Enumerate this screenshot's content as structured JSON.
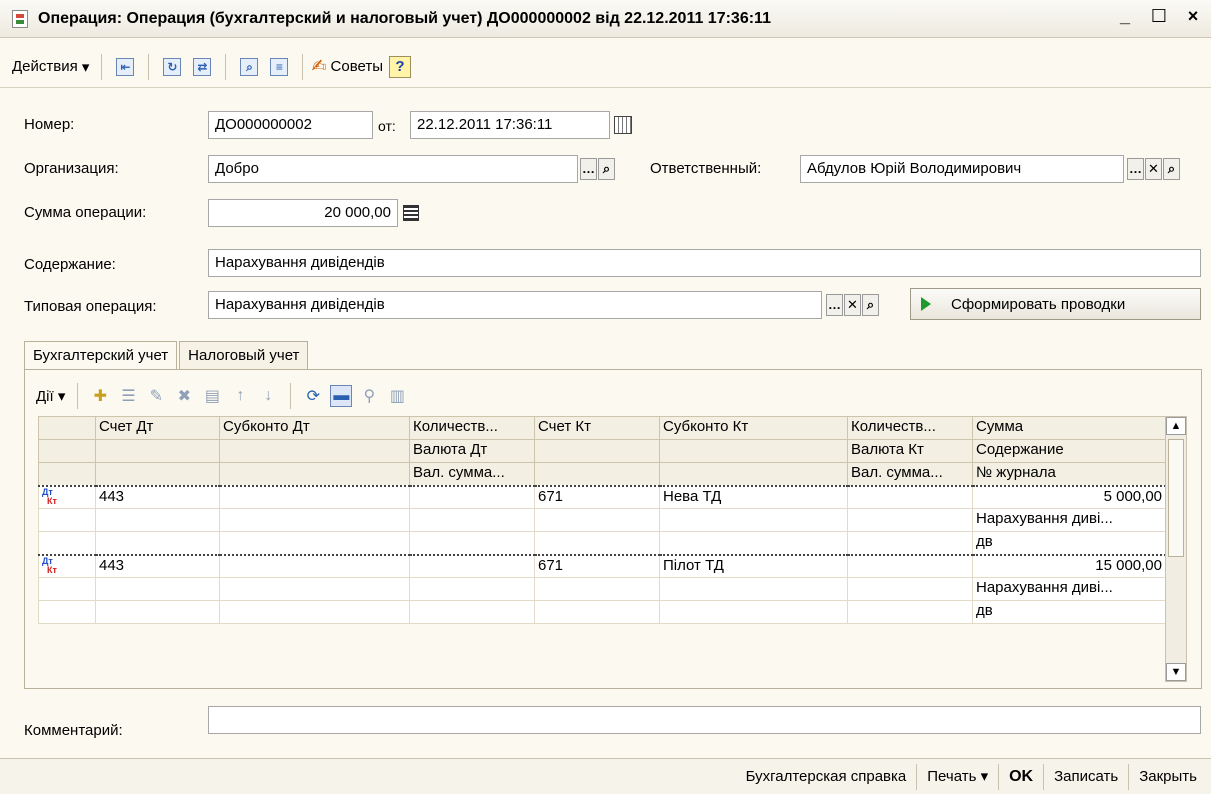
{
  "window": {
    "title": "Операция: Операция (бухгалтерский и налоговый учет) ДО000000002 від 22.12.2011 17:36:11",
    "minimize": "_",
    "maximize": "☐",
    "close": "×"
  },
  "toolbar": {
    "actions_label": "Действия",
    "advice_label": "Советы",
    "help_label": "?"
  },
  "form": {
    "number_label": "Номер:",
    "number_value": "ДО000000002",
    "from_label": "от:",
    "date_value": "22.12.2011 17:36:11",
    "org_label": "Организация:",
    "org_value": "Добро",
    "responsible_label": "Ответственный:",
    "responsible_value": "Абдулов Юрій Володимирович",
    "amount_label": "Сумма операции:",
    "amount_value": "20 000,00",
    "content_label": "Содержание:",
    "content_value": "Нарахування дивідендів",
    "typical_label": "Типовая операция:",
    "typical_value": "Нарахування дивідендів",
    "generate_button": "Сформировать проводки",
    "comment_label": "Комментарий:",
    "comment_value": ""
  },
  "tabs": [
    "Бухгалтерский учет",
    "Налоговый учет"
  ],
  "grid_toolbar": {
    "actions_label": "Дії"
  },
  "grid": {
    "headers": {
      "row1": [
        "",
        "Счет Дт",
        "Субконто Дт",
        "Количеств...",
        "Счет Кт",
        "Субконто Кт",
        "Количеств...",
        "Сумма"
      ],
      "row2": [
        "Валюта Дт",
        "Валюта Кт",
        "Содержание"
      ],
      "row3": [
        "Вал. сумма...",
        "Вал. сумма...",
        "№ журнала"
      ]
    },
    "rows": [
      {
        "dt": "Дт",
        "kt": "Кт",
        "acc_dt": "443",
        "acc_kt": "671",
        "sub_kt": "Нева ТД",
        "sum": "5 000,00",
        "content": "Нарахування диві...",
        "journal": "дв"
      },
      {
        "dt": "Дт",
        "kt": "Кт",
        "acc_dt": "443",
        "acc_kt": "671",
        "sub_kt": "Пілот ТД",
        "sum": "15 000,00",
        "content": "Нарахування диві...",
        "journal": "дв"
      }
    ]
  },
  "statusbar": {
    "report": "Бухгалтерская справка",
    "print": "Печать",
    "ok": "OK",
    "save": "Записать",
    "close": "Закрыть"
  }
}
